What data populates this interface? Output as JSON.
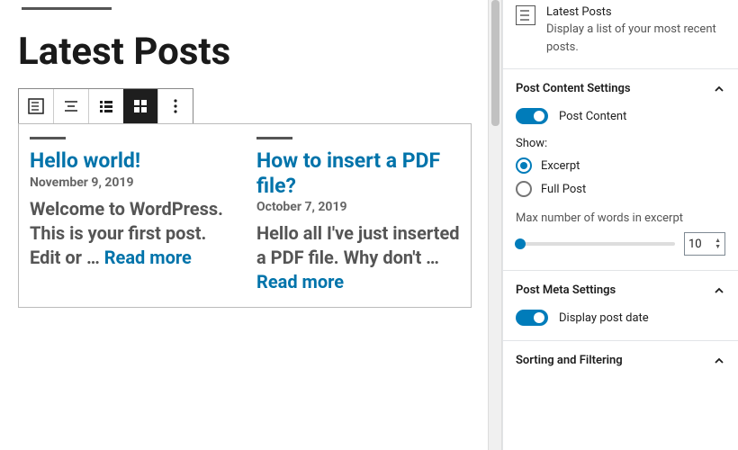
{
  "page": {
    "title": "Latest Posts"
  },
  "posts": [
    {
      "title": "Hello world!",
      "date": "November 9, 2019",
      "excerpt": "Welcome to WordPress. This is your first post. Edit or … ",
      "readmore": "Read more"
    },
    {
      "title": "How to insert a PDF file?",
      "date": "October 7, 2019",
      "excerpt": "Hello all I've just inserted a PDF file. Why don't … ",
      "readmore": "Read more"
    }
  ],
  "block_info": {
    "name": "Latest Posts",
    "description": "Display a list of your most recent posts."
  },
  "panels": {
    "content": {
      "title": "Post Content Settings",
      "toggle_label": "Post Content",
      "toggle_on": true,
      "show_label": "Show:",
      "options": {
        "excerpt": "Excerpt",
        "full": "Full Post"
      },
      "selected": "excerpt",
      "max_words_label": "Max number of words in excerpt",
      "max_words_value": "10"
    },
    "meta": {
      "title": "Post Meta Settings",
      "toggle_label": "Display post date",
      "toggle_on": true
    },
    "sort": {
      "title": "Sorting and Filtering"
    }
  }
}
